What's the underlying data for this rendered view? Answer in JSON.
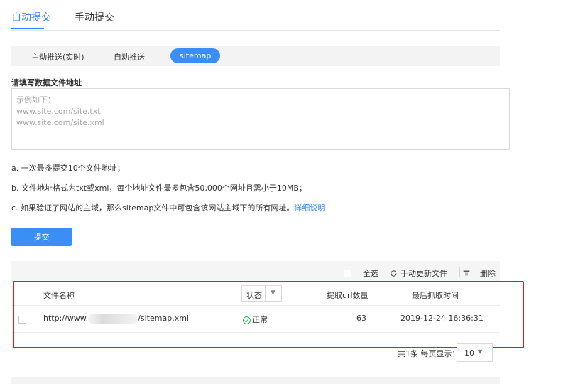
{
  "top_tabs": {
    "auto": "自动提交",
    "manual": "手动提交"
  },
  "sub_tabs": {
    "active_push": "主动推送(实时)",
    "auto_push": "自动推送",
    "sitemap": "sitemap"
  },
  "form": {
    "label": "请填写数据文件地址",
    "placeholder": "示例如下：\nwww.site.com/site.txt\nwww.site.com/site.xml"
  },
  "notes": {
    "a": "a. 一次最多提交10个文件地址；",
    "b": "b. 文件地址格式为txt或xml，每个地址文件最多包含50,000个网址且需小于10MB；",
    "c": "c. 如果验证了网站的主域，那么sitemap文件中可包含该网站主域下的所有网址。",
    "c_link": "详细说明"
  },
  "submit_label": "提交",
  "toolbar": {
    "select_all": "全选",
    "refresh": "手动更新文件",
    "delete": "删除"
  },
  "table": {
    "headers": {
      "file_name": "文件名称",
      "status": "状态",
      "url_count": "提取url数量",
      "last_crawl": "最后抓取时间"
    },
    "rows": [
      {
        "url_prefix": "http://www.",
        "url_suffix": "/sitemap.xml",
        "status": "正常",
        "url_count": "63",
        "last_crawl": "2019-12-24 16:36:31"
      }
    ]
  },
  "pagination": {
    "summary": "共1条  每页显示：",
    "page_size": "10"
  },
  "icons": {
    "refresh": "refresh-icon",
    "delete": "trash-icon",
    "status_ok": "check-circle-icon",
    "dropdown": "caret-down-icon"
  },
  "colors": {
    "accent": "#3385ff",
    "button": "#3a8ef6",
    "success": "#2fb352",
    "highlight": "#e21a1a"
  }
}
